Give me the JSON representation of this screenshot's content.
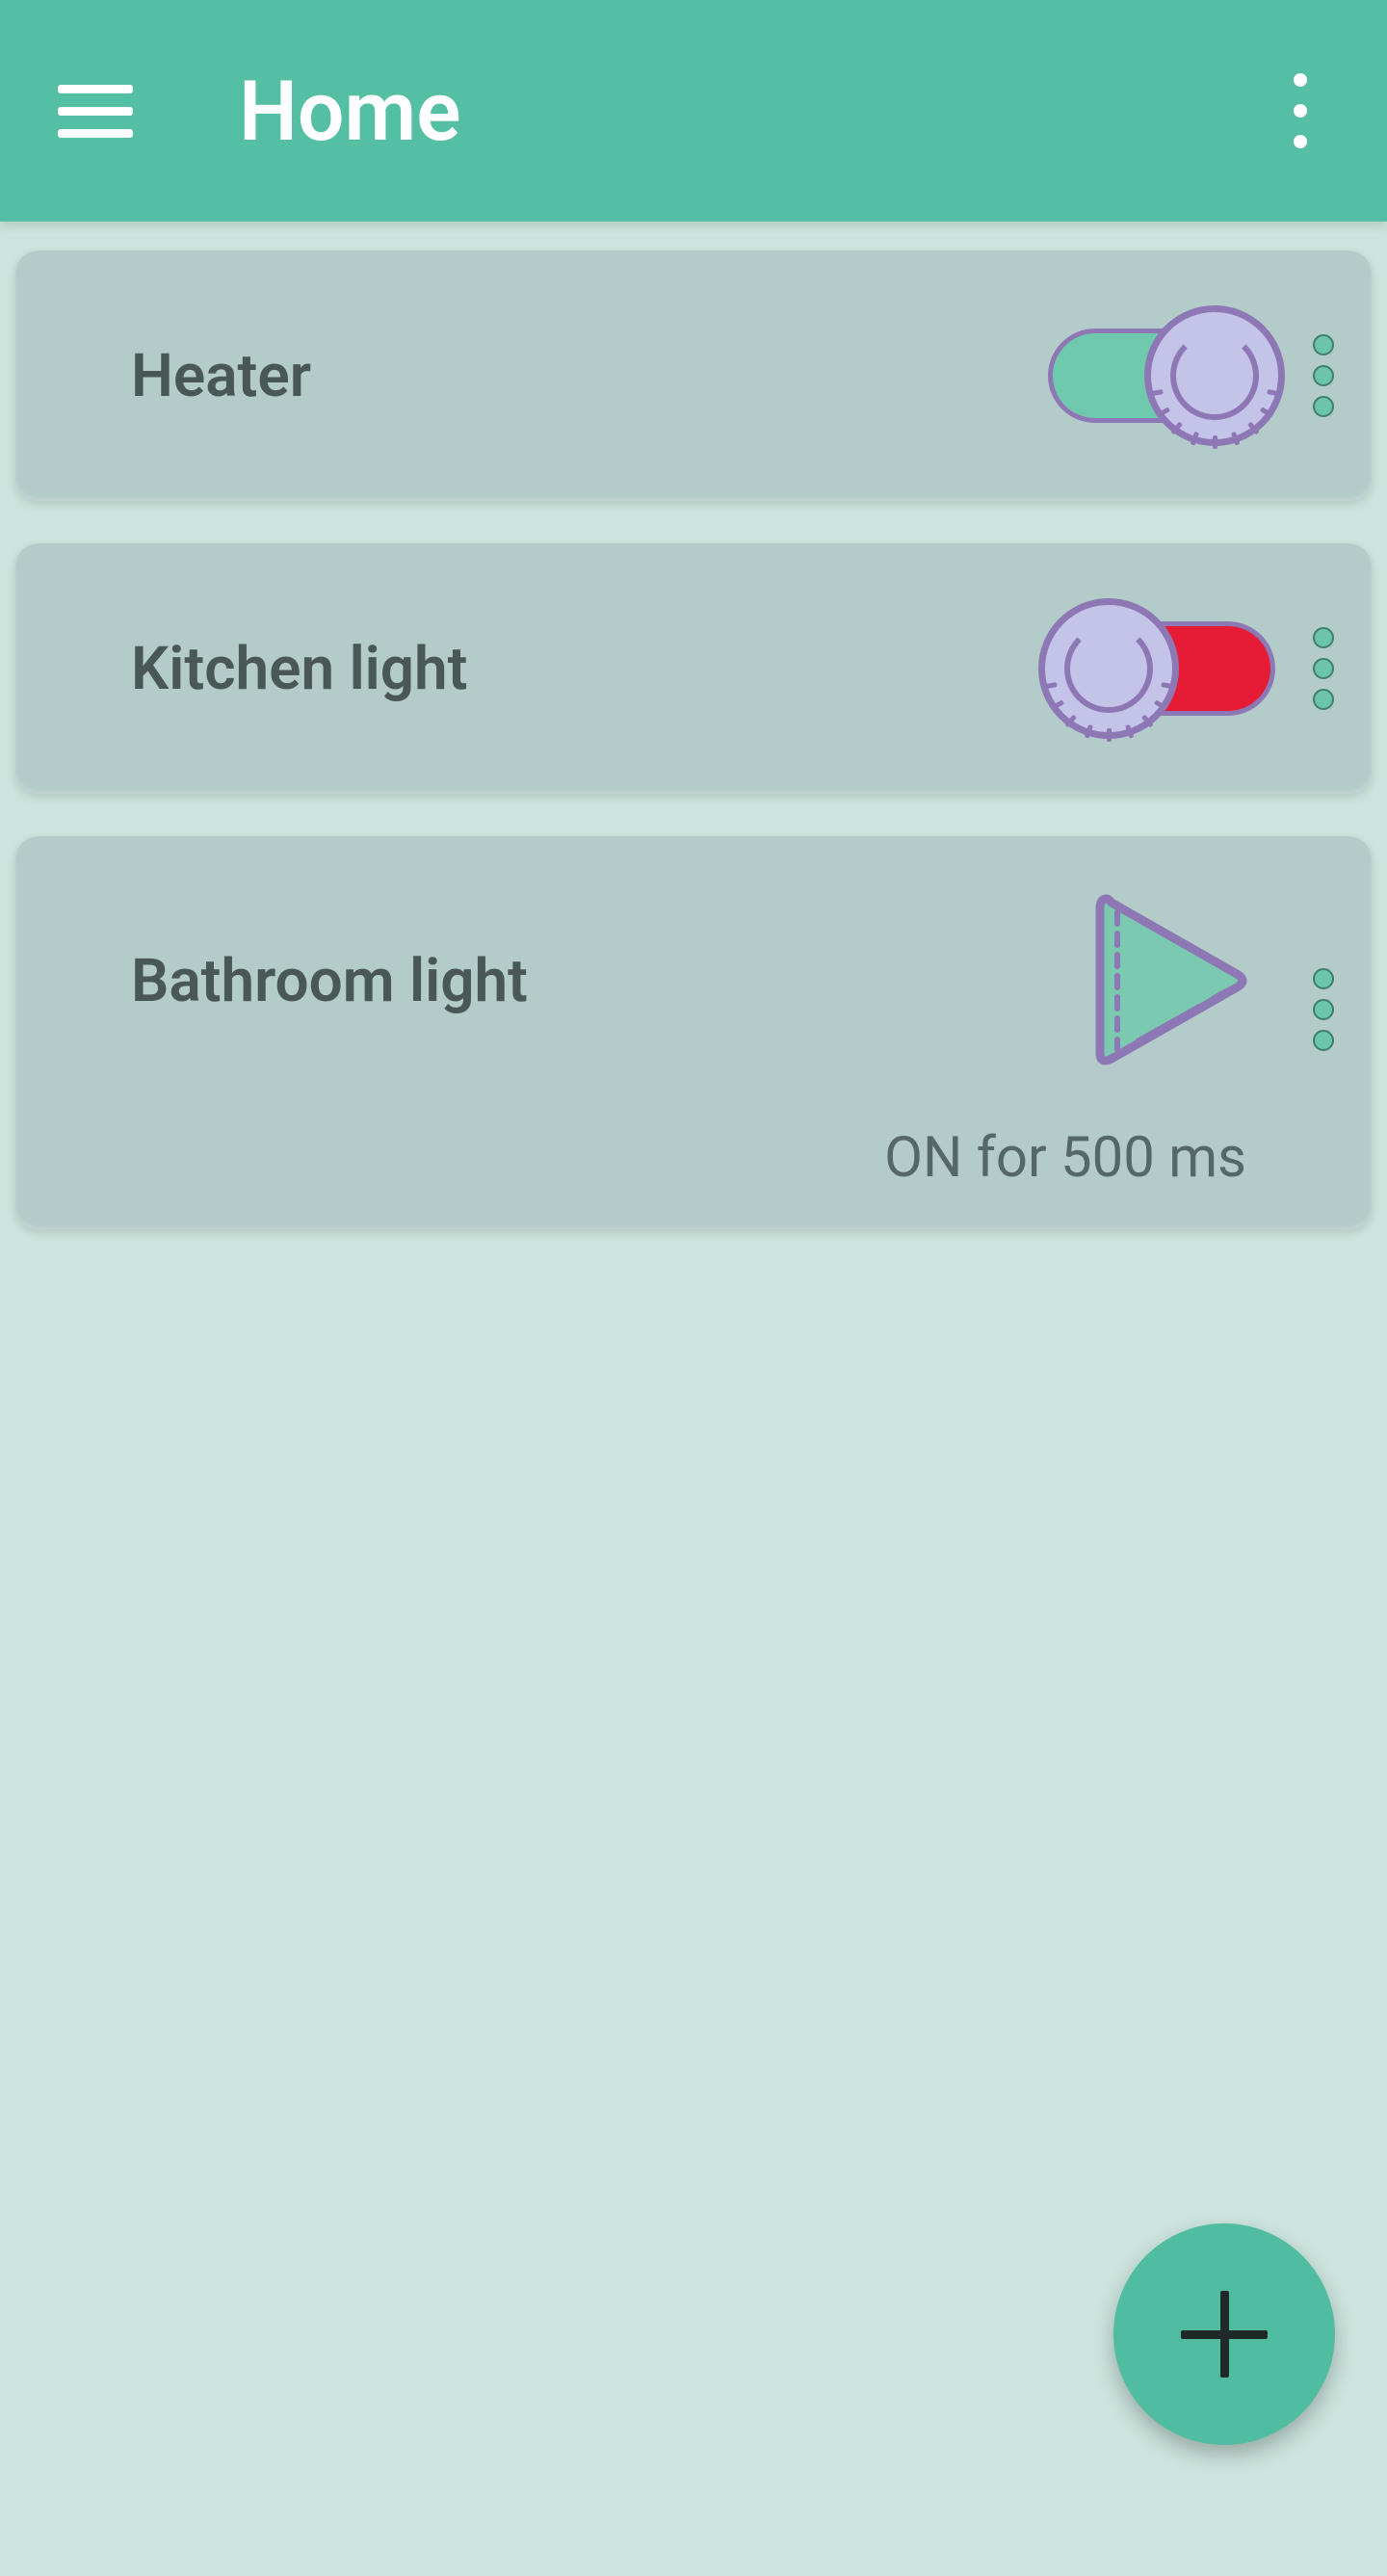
{
  "appbar": {
    "title": "Home"
  },
  "devices": [
    {
      "label": "Heater",
      "type": "toggle",
      "state": "on"
    },
    {
      "label": "Kitchen light",
      "type": "toggle",
      "state": "off"
    },
    {
      "label": "Bathroom light",
      "type": "play",
      "caption": "ON for 500 ms"
    }
  ],
  "colors": {
    "accent": "#55bfa4",
    "card": "#b3cbc9",
    "knob": "#c4c3e8",
    "purple": "#8d78b5",
    "off_red": "#e61b36",
    "on_green": "#6fcaad"
  }
}
